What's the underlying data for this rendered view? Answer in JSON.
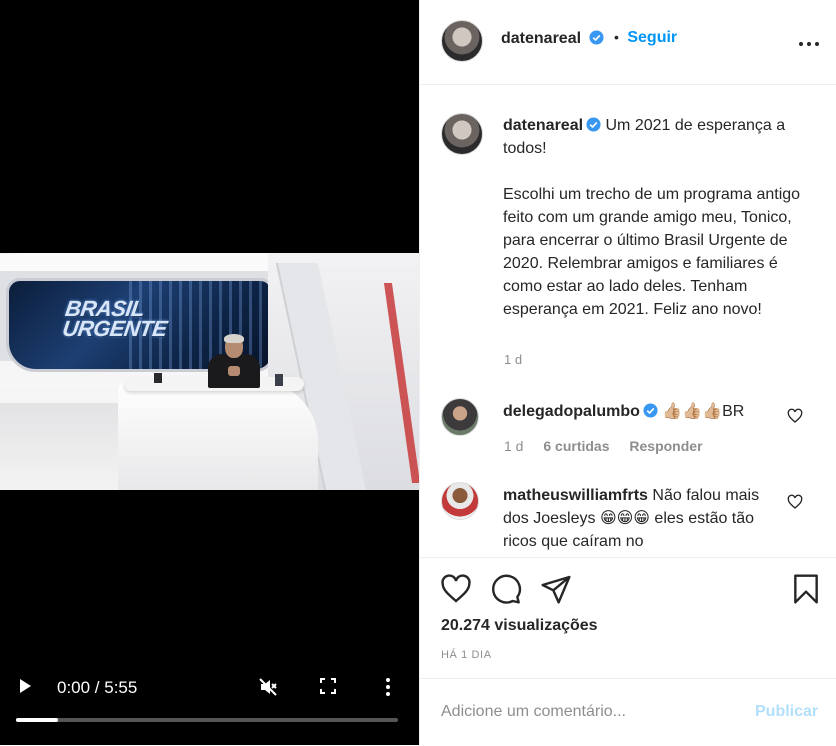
{
  "video": {
    "scene_logo_line1": "BRASIL",
    "scene_logo_line2": "URGENTE",
    "time_display": "0:00 / 5:55",
    "progress_fraction": 0.11,
    "icons": [
      "play-icon",
      "mute-icon",
      "fullscreen-icon",
      "more-vertical-icon"
    ]
  },
  "header": {
    "username": "datenareal",
    "separator": "•",
    "follow_label": "Seguir",
    "more_icon": "more-horizontal-icon"
  },
  "caption": {
    "username": "datenareal",
    "line1": "Um 2021 de esperança a todos!",
    "paragraph2": "Escolhi um trecho de um programa antigo feito com um grande amigo meu, Tonico, para encerrar o último Brasil Urgente de 2020. Relembrar amigos e familiares é como estar ao lado deles. Tenham esperança em 2021. Feliz ano novo!",
    "time": "1 d"
  },
  "comments": [
    {
      "username": "delegadopalumbo",
      "text": "👍🏼👍🏼👍🏼BR",
      "time": "1 d",
      "likes": "6 curtidas",
      "reply": "Responder"
    },
    {
      "username": "matheuswilliamfrts",
      "text": "Não falou mais dos Joesleys 😁😁😁 eles estão tão ricos que caíram no"
    }
  ],
  "actions": {
    "views": "20.274 visualizações",
    "posted_ago": "HÁ 1 DIA"
  },
  "add_comment": {
    "placeholder": "Adicione um comentário...",
    "post_label": "Publicar"
  },
  "colors": {
    "accent": "#0095f6",
    "post_disabled": "#b2dffc",
    "muted_text": "#8e8e8e",
    "primary_text": "#262626"
  }
}
